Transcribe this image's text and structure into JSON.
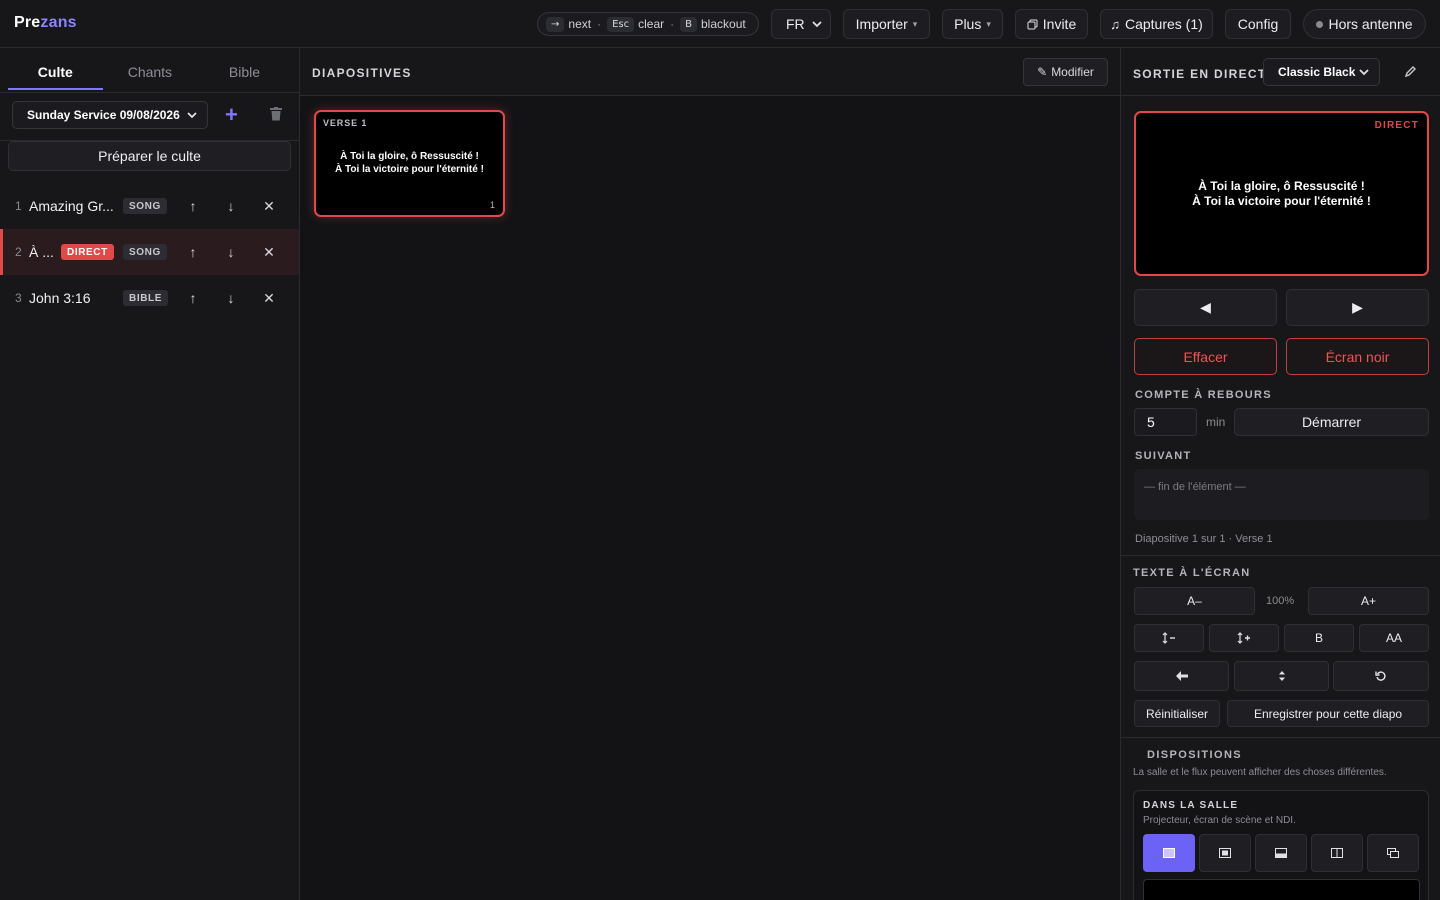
{
  "app": {
    "logo_part1": "Pre",
    "logo_part2": "zans",
    "accent": "#8b83ff",
    "live_color": "#e24848"
  },
  "shortcuts": [
    {
      "key": "→",
      "label": "next"
    },
    {
      "key": "Esc",
      "label": "clear"
    },
    {
      "key": "B",
      "label": "blackout"
    }
  ],
  "topbar": {
    "language": "FR",
    "import_label": "Importer",
    "more_label": "Plus",
    "invite_label": "Invite",
    "captures_label": "Captures (1)",
    "config_label": "Config",
    "status_label": "Hors antenne"
  },
  "left": {
    "tabs": [
      "Culte",
      "Chants",
      "Bible"
    ],
    "active_tab": "Culte",
    "service_name": "Sunday Service 09/08/2026",
    "prepare_label": "Préparer le culte",
    "items": [
      {
        "num": "1",
        "title": "Amazing Gr...",
        "type": "SONG",
        "live": false
      },
      {
        "num": "2",
        "title": "À ...",
        "type": "SONG",
        "live": true,
        "live_badge": "DIRECT"
      },
      {
        "num": "3",
        "title": "John 3:16",
        "type": "BIBLE",
        "live": false
      }
    ]
  },
  "middle": {
    "section_title": "DIAPOSITIVES",
    "modify_label": "Modifier",
    "slides": [
      {
        "label": "VERSE 1",
        "line1": "À Toi la gloire, ô Ressuscité !",
        "line2": "À Toi la victoire pour l'éternité !",
        "index": "1",
        "live": true
      }
    ]
  },
  "right": {
    "section_title": "SORTIE EN DIRECT",
    "theme": "Classic Black",
    "preview_badge": "DIRECT",
    "preview_line1": "À Toi la gloire, ô Ressuscité !",
    "preview_line2": "À Toi la victoire pour l'éternité !",
    "prev_label": "◀",
    "next_label": "▶",
    "clear_label": "Effacer",
    "blackout_label": "Écran noir",
    "countdown_title": "COMPTE À REBOURS",
    "countdown_value": "5",
    "countdown_unit": "min",
    "countdown_start": "Démarrer",
    "next_title": "SUIVANT",
    "next_text": "— fin de l'élément —",
    "slide_info": "Diapositive 1 sur 1 · Verse 1",
    "text_title": "TEXTE À L'ÉCRAN",
    "font_smaller": "A–",
    "font_pct": "100%",
    "font_bigger": "A+",
    "bold_label": "B",
    "caps_label": "AA",
    "reset_label": "Réinitialiser",
    "save_label": "Enregistrer pour cette diapo",
    "layouts_title": "DISPOSITIONS",
    "layouts_desc": "La salle et le flux peuvent afficher des choses différentes.",
    "room_title": "DANS LA SALLE",
    "room_desc": "Projecteur, écran de scène et NDI."
  }
}
